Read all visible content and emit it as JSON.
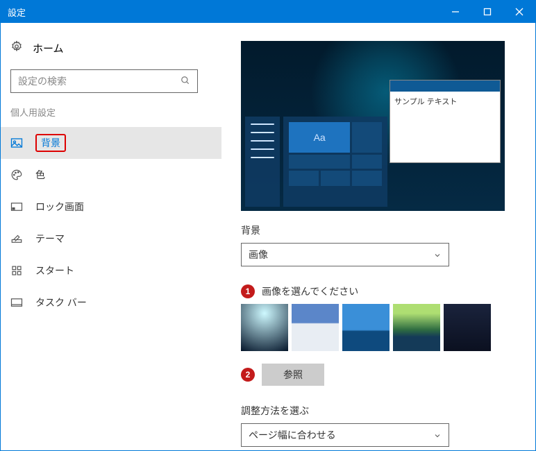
{
  "window": {
    "title": "設定"
  },
  "home": "ホーム",
  "search_placeholder": "設定の検索",
  "section": "個人用設定",
  "items": [
    {
      "label": "背景"
    },
    {
      "label": "色"
    },
    {
      "label": "ロック画面"
    },
    {
      "label": "テーマ"
    },
    {
      "label": "スタート"
    },
    {
      "label": "タスク バー"
    }
  ],
  "preview": {
    "sample": "サンプル テキスト",
    "aa": "Aa"
  },
  "bg": {
    "label": "背景",
    "value": "画像"
  },
  "step1": {
    "num": "1",
    "label": "画像を選んでください"
  },
  "step2": {
    "num": "2",
    "label": "参照"
  },
  "fit": {
    "label": "調整方法を選ぶ",
    "value": "ページ幅に合わせる"
  }
}
